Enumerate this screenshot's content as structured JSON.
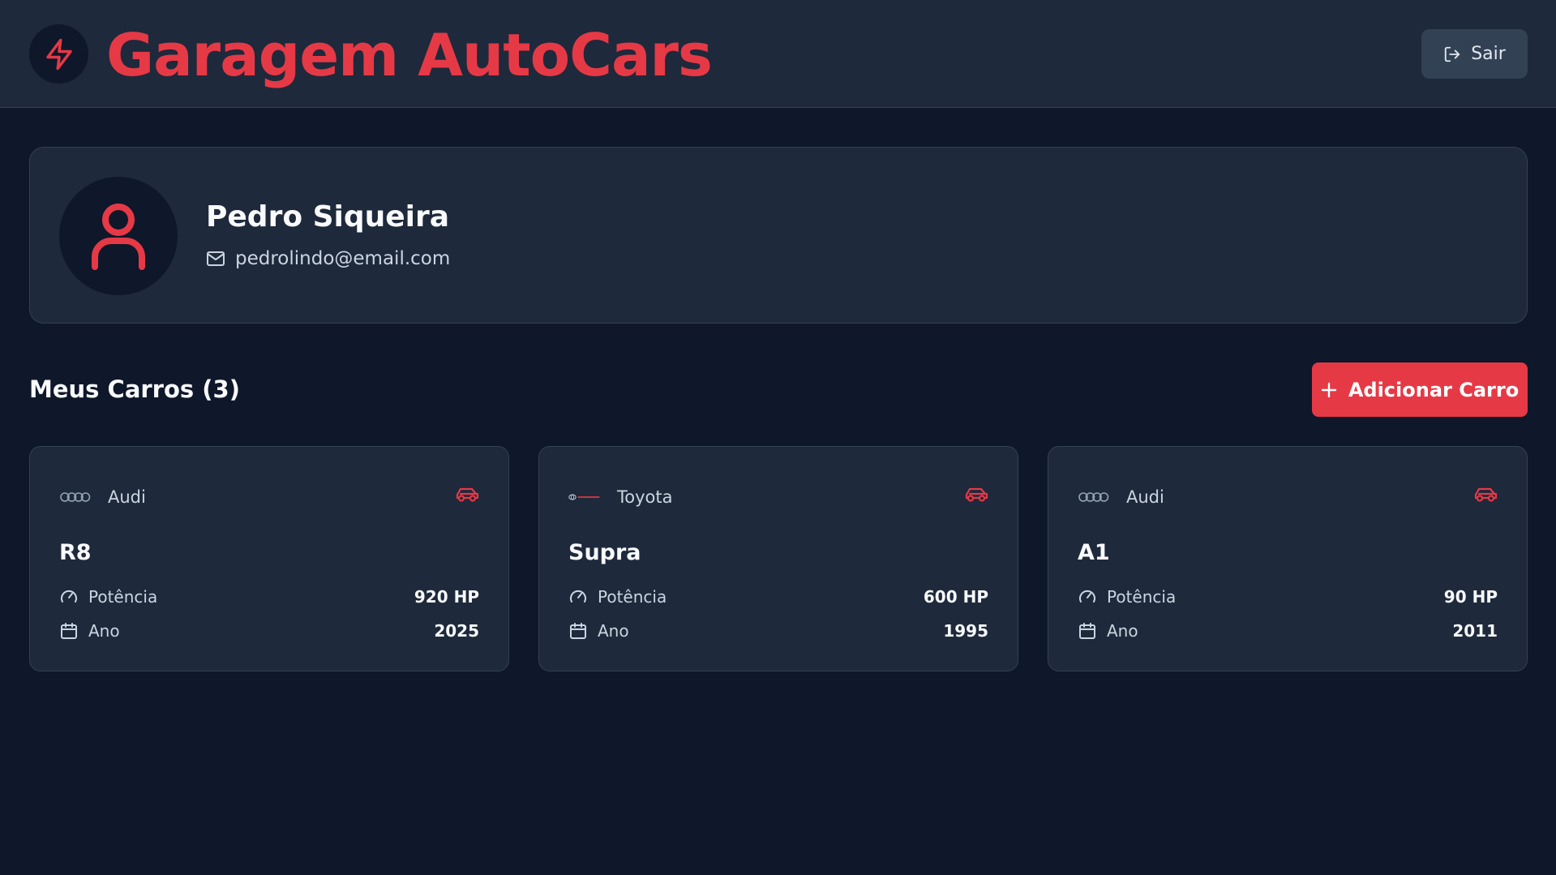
{
  "header": {
    "title": "Garagem AutoCars",
    "logout_label": "Sair",
    "logo_icon": "bolt-icon",
    "accent_color": "#e63946"
  },
  "profile": {
    "name": "Pedro Siqueira",
    "email": "pedrolindo@email.com",
    "avatar_icon": "user-icon"
  },
  "cars_section": {
    "title": "Meus Carros (3)",
    "add_button_label": "Adicionar Carro"
  },
  "cars": [
    {
      "brand": "Audi",
      "brand_logo": "audi-rings-logo",
      "model": "R8",
      "power_label": "Potência",
      "power": "920 HP",
      "year_label": "Ano",
      "year": "2025"
    },
    {
      "brand": "Toyota",
      "brand_logo": "toyota-logo",
      "model": "Supra",
      "power_label": "Potência",
      "power": "600 HP",
      "year_label": "Ano",
      "year": "1995"
    },
    {
      "brand": "Audi",
      "brand_logo": "audi-rings-logo",
      "model": "A1",
      "power_label": "Potência",
      "power": "90 HP",
      "year_label": "Ano",
      "year": "2011"
    }
  ]
}
